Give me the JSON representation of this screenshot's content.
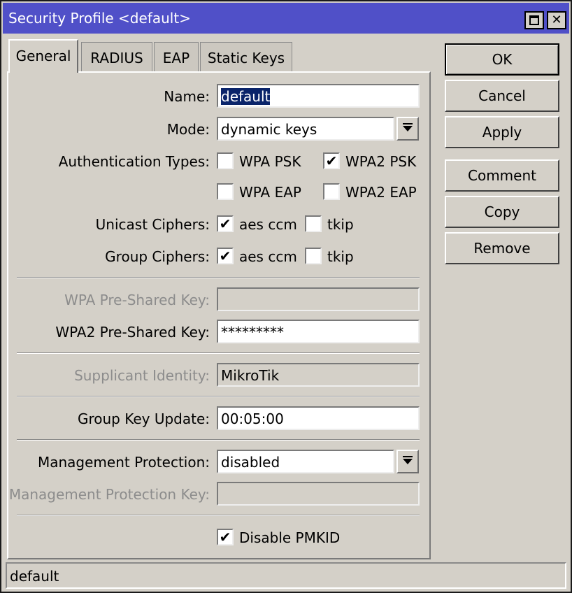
{
  "window": {
    "title": "Security Profile <default>"
  },
  "tabs": [
    "General",
    "RADIUS",
    "EAP",
    "Static Keys"
  ],
  "general": {
    "name": {
      "label": "Name:",
      "value": "default"
    },
    "mode": {
      "label": "Mode:",
      "value": "dynamic keys"
    },
    "auth_types": {
      "label": "Authentication Types:",
      "options": [
        {
          "label": "WPA PSK",
          "checked": false
        },
        {
          "label": "WPA2 PSK",
          "checked": true
        },
        {
          "label": "WPA EAP",
          "checked": false
        },
        {
          "label": "WPA2 EAP",
          "checked": false
        }
      ]
    },
    "unicast": {
      "label": "Unicast Ciphers:",
      "options": [
        {
          "label": "aes ccm",
          "checked": true
        },
        {
          "label": "tkip",
          "checked": false
        }
      ]
    },
    "group": {
      "label": "Group Ciphers:",
      "options": [
        {
          "label": "aes ccm",
          "checked": true
        },
        {
          "label": "tkip",
          "checked": false
        }
      ]
    },
    "wpa_psk": {
      "label": "WPA Pre-Shared Key:",
      "value": ""
    },
    "wpa2_psk": {
      "label": "WPA2 Pre-Shared Key:",
      "value": "*********"
    },
    "supplicant": {
      "label": "Supplicant Identity:",
      "value": "MikroTik"
    },
    "group_key_update": {
      "label": "Group Key Update:",
      "value": "00:05:00"
    },
    "mgmt_protection": {
      "label": "Management Protection:",
      "value": "disabled"
    },
    "mgmt_protection_key": {
      "label": "Management Protection Key:",
      "value": ""
    },
    "disable_pmkid": {
      "label": "Disable PMKID",
      "checked": true
    }
  },
  "buttons": [
    "OK",
    "Cancel",
    "Apply",
    "Comment",
    "Copy",
    "Remove"
  ],
  "status": "default",
  "check_mark": "✔",
  "close_glyph": "✕"
}
